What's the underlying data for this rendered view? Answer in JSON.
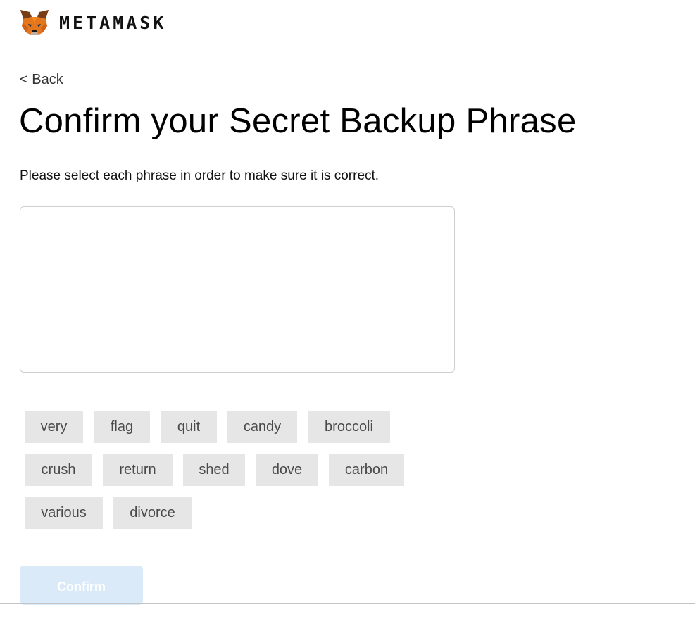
{
  "brand": {
    "wordmark": "METAMASK",
    "logo_icon": "metamask-fox-icon"
  },
  "nav": {
    "back_label": "< Back"
  },
  "page": {
    "title": "Confirm your Secret Backup Phrase",
    "subtitle": "Please select each phrase in order to make sure it is correct."
  },
  "selected_phrase": [],
  "words": [
    "very",
    "flag",
    "quit",
    "candy",
    "broccoli",
    "crush",
    "return",
    "shed",
    "dove",
    "carbon",
    "various",
    "divorce"
  ],
  "actions": {
    "confirm_label": "Confirm",
    "confirm_enabled": false
  },
  "colors": {
    "fox_orange": "#E2761B",
    "chip_background": "#E6E6E6",
    "confirm_disabled": "#DBEAF8"
  }
}
